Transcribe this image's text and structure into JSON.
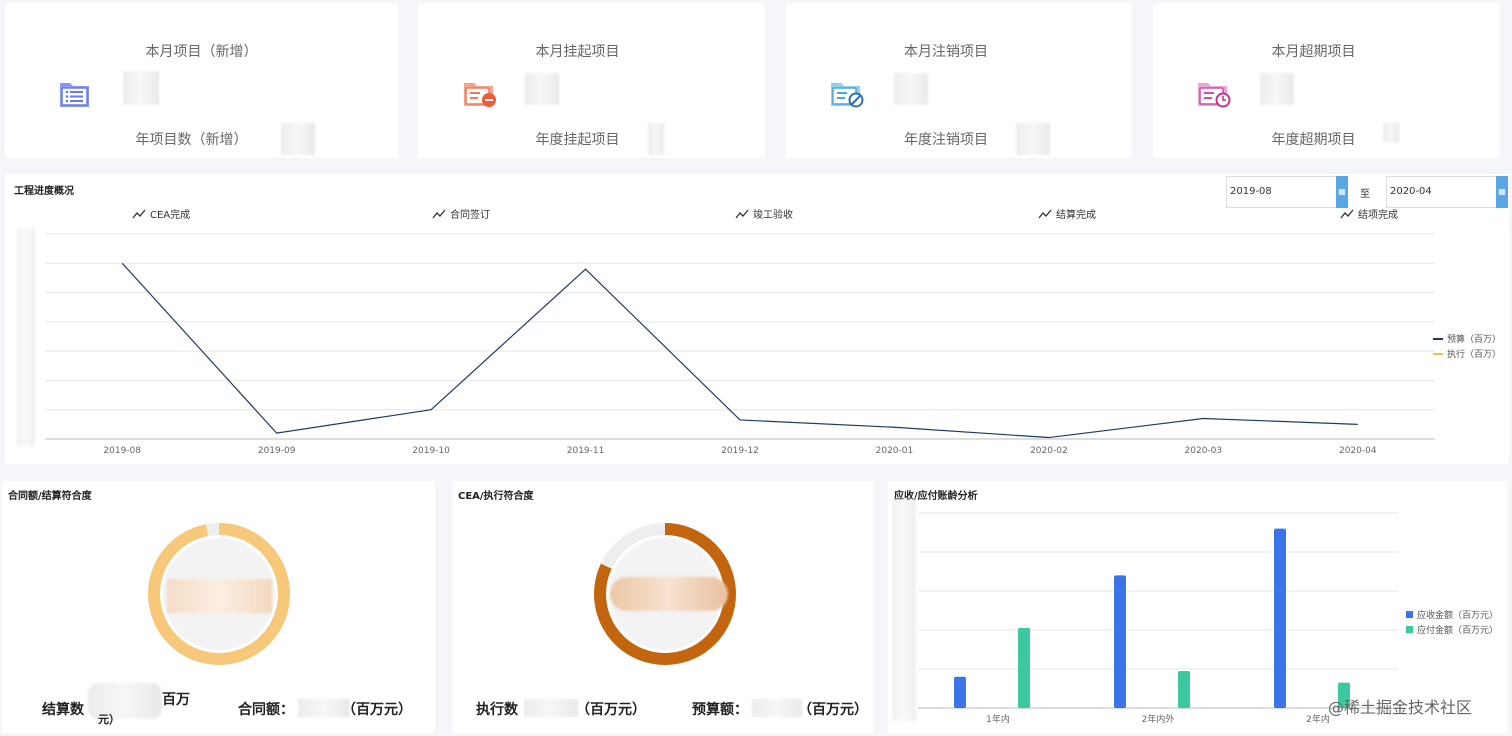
{
  "stats": [
    {
      "month_label": "本月项目（新增）",
      "year_label": "年项目数（新增）",
      "icon": "project-list-icon",
      "color": "#6a7ae8"
    },
    {
      "month_label": "本月挂起项目",
      "year_label": "年度挂起项目",
      "icon": "folder-minus-icon",
      "color": "#ef7b5a"
    },
    {
      "month_label": "本月注销项目",
      "year_label": "年度注销项目",
      "icon": "folder-cancel-icon",
      "color": "#4aa8d8"
    },
    {
      "month_label": "本月超期项目",
      "year_label": "年度超期项目",
      "icon": "folder-clock-icon",
      "color": "#d44fa8"
    }
  ],
  "progress": {
    "title": "工程进度概况",
    "date_from": "2019-08",
    "date_sep": "至",
    "date_to": "2020-04",
    "tabs": [
      "CEA完成",
      "合同签订",
      "竣工验收",
      "结算完成",
      "结项完成"
    ],
    "legend": [
      {
        "name": "预算（百万）",
        "color": "#1f3a5f"
      },
      {
        "name": "执行（百万）",
        "color": "#f0c04a"
      }
    ]
  },
  "chart_data": [
    {
      "type": "line",
      "x": [
        "2019-08",
        "2019-09",
        "2019-10",
        "2019-11",
        "2019-12",
        "2020-01",
        "2020-02",
        "2020-03",
        "2020-04"
      ],
      "series": [
        {
          "name": "预算（百万）",
          "values": [
            6.0,
            0.2,
            1.0,
            5.8,
            0.65,
            0.4,
            0.05,
            0.7,
            0.5
          ],
          "color": "#1f3a5f"
        },
        {
          "name": "执行（百万）",
          "values": [],
          "color": "#f0c04a"
        }
      ],
      "ylim": [
        0,
        7
      ],
      "grid": true,
      "legend_position": "right"
    },
    {
      "type": "bar",
      "categories": [
        "1年内",
        "2年内外",
        "2年内"
      ],
      "series": [
        {
          "name": "应收金额（百万元）",
          "values": [
            0.8,
            3.4,
            4.6
          ],
          "color": "#3a74e8"
        },
        {
          "name": "应付金额（百万元）",
          "values": [
            2.05,
            0.95,
            0.65
          ],
          "color": "#3cc8a0"
        }
      ],
      "ylim": [
        0,
        5
      ],
      "grid": true,
      "legend_position": "right"
    }
  ],
  "contract": {
    "title": "合同额/结算符合度",
    "ratio": 0.97,
    "ring_color": "#f7c87a",
    "settle_label": "结算数",
    "settle_unit": "百万",
    "settle_unit2": "元）",
    "contract_label": "合同额：",
    "contract_unit": "（百万元）"
  },
  "cea": {
    "title": "CEA/执行符合度",
    "ratio": 0.82,
    "ring_color": "#c2650e",
    "exec_label": "执行数",
    "exec_unit": "（百万元）",
    "budget_label": "预算额：",
    "budget_unit": "（百万元）"
  },
  "aging": {
    "title": "应收/应付账龄分析"
  },
  "watermark": "@稀土掘金技术社区"
}
